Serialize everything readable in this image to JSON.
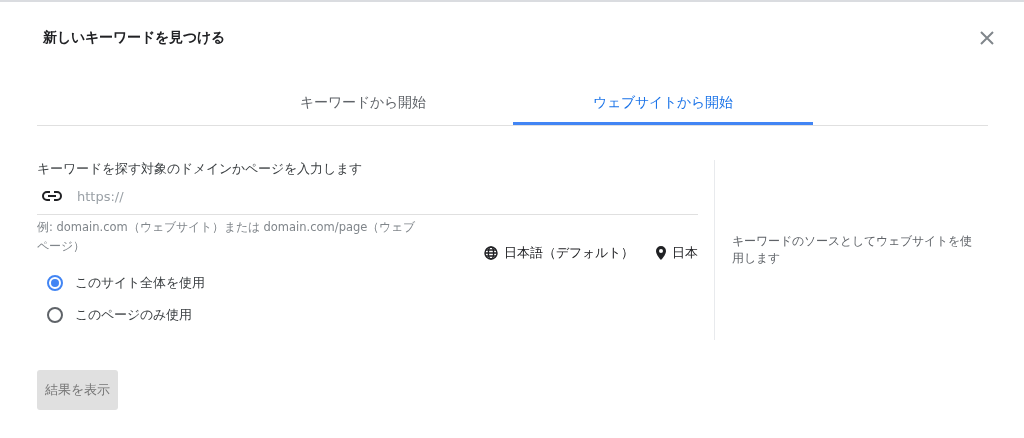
{
  "dialog": {
    "title": "新しいキーワードを見つける"
  },
  "tabs": [
    {
      "label": "キーワードから開始",
      "selected": false
    },
    {
      "label": "ウェブサイトから開始",
      "selected": true
    }
  ],
  "form": {
    "prompt": "キーワードを探す対象のドメインかページを入力します",
    "url_field": {
      "placeholder": "https://"
    },
    "hint": "例: domain.com（ウェブサイト）または domain.com/page（ウェブページ）",
    "language": "日本語（デフォルト）",
    "location": "日本",
    "scope_options": [
      {
        "label": "このサイト全体を使用",
        "selected": true
      },
      {
        "label": "このページのみ使用",
        "selected": false
      }
    ]
  },
  "side_note": "キーワードのソースとしてウェブサイトを使用します",
  "submit": {
    "label": "結果を表示",
    "disabled": true
  }
}
